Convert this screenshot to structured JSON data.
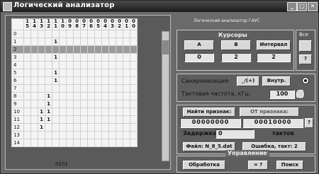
{
  "window": {
    "title": "Логический анализатор",
    "minimize": "_",
    "maximize": "□",
    "close": "✕"
  },
  "grid": {
    "columns": [
      [
        "1",
        "5"
      ],
      [
        "1",
        "4"
      ],
      [
        "1",
        "3"
      ],
      [
        "1",
        "2"
      ],
      [
        "1",
        "1"
      ],
      [
        "1",
        "0"
      ],
      [
        "0",
        "9"
      ],
      [
        "0",
        "8"
      ],
      [
        "0",
        "7"
      ],
      [
        "0",
        "6"
      ],
      [
        "0",
        "5"
      ],
      [
        "0",
        "4"
      ],
      [
        "0",
        "3"
      ],
      [
        "0",
        "2"
      ],
      [
        "0",
        "1"
      ],
      [
        "0",
        "0"
      ]
    ],
    "rows": [
      {
        "label": "0",
        "cells": [
          "",
          "",
          "",
          "",
          "",
          "",
          "",
          "",
          "",
          "",
          "",
          "",
          "",
          "",
          "",
          ""
        ]
      },
      {
        "label": "1",
        "cells": [
          "",
          "",
          "",
          "",
          "1",
          "",
          "",
          "",
          "",
          "",
          "",
          "",
          "",
          "",
          "",
          ""
        ]
      },
      {
        "label": "2",
        "cells": [
          "",
          "",
          "",
          "",
          "",
          "",
          "",
          "",
          "",
          "",
          "",
          "",
          "",
          "",
          "",
          ""
        ]
      },
      {
        "label": "3",
        "cells": [
          "",
          "",
          "",
          "",
          "1",
          "",
          "",
          "",
          "",
          "",
          "",
          "",
          "",
          "",
          "",
          ""
        ]
      },
      {
        "label": "4",
        "cells": [
          "",
          "",
          "",
          "",
          "",
          "",
          "",
          "",
          "",
          "",
          "",
          "",
          "",
          "",
          "",
          ""
        ]
      },
      {
        "label": "5",
        "cells": [
          "",
          "",
          "",
          "",
          "1",
          "",
          "",
          "",
          "",
          "",
          "",
          "",
          "",
          "",
          "",
          ""
        ]
      },
      {
        "label": "6",
        "cells": [
          "",
          "",
          "",
          "",
          "1",
          "",
          "",
          "",
          "",
          "",
          "",
          "",
          "",
          "",
          "",
          ""
        ]
      },
      {
        "label": "7",
        "cells": [
          "",
          "",
          "",
          "",
          "",
          "",
          "",
          "",
          "",
          "",
          "",
          "",
          "",
          "",
          "",
          ""
        ]
      },
      {
        "label": "8",
        "cells": [
          "",
          "",
          "",
          "1",
          "",
          "",
          "",
          "",
          "",
          "",
          "",
          "",
          "",
          "",
          "",
          ""
        ]
      },
      {
        "label": "9",
        "cells": [
          "",
          "",
          "",
          "1",
          "",
          "",
          "",
          "",
          "",
          "",
          "",
          "",
          "",
          "",
          "",
          ""
        ]
      },
      {
        "label": "10",
        "cells": [
          "",
          "",
          "1",
          "1",
          "",
          "",
          "",
          "",
          "",
          "",
          "",
          "",
          "",
          "",
          "",
          ""
        ]
      },
      {
        "label": "11",
        "cells": [
          "",
          "",
          "1",
          "1",
          "",
          "",
          "",
          "",
          "",
          "",
          "",
          "",
          "",
          "",
          "",
          ""
        ]
      },
      {
        "label": "12",
        "cells": [
          "",
          "",
          "1",
          "",
          "",
          "",
          "",
          "",
          "",
          "",
          "",
          "",
          "",
          "",
          "",
          ""
        ]
      },
      {
        "label": "13",
        "cells": [
          "",
          "",
          "",
          "",
          "",
          "",
          "",
          "",
          "",
          "",
          "",
          "",
          "",
          "",
          "",
          ""
        ]
      },
      {
        "label": "14",
        "cells": [
          "",
          "",
          "",
          "",
          "",
          "",
          "",
          "",
          "",
          "",
          "",
          "",
          "",
          "",
          "",
          ""
        ]
      }
    ],
    "highlighted_row": 2,
    "bottom_code": "0101"
  },
  "top_right": {
    "title": "Логический анализатор ГАУС",
    "all_label": "Все"
  },
  "cursors": {
    "header": "Курсоры",
    "a_label": "А",
    "b_label": "В",
    "interval_label": "Интервал",
    "a_value": "0",
    "b_value": "2",
    "interval_value": "2",
    "help": "?"
  },
  "sync": {
    "label": "Синхронизация:",
    "edge": "_/(+)",
    "source": "Внутр.",
    "clock_label": "Тактовая частота, кГц:",
    "clock_value": "100"
  },
  "search": {
    "find_button": "Найти признак:",
    "from_label": "ОТ признака:",
    "pattern_a": "00000000",
    "pattern_b": "00010000",
    "delay_label": "Задержка:",
    "delay_value": "0",
    "tacts_label": "тактов",
    "file_label": "Файл: N_8_5.dat",
    "error_label": "Ошибка, такт: 2"
  },
  "control": {
    "header": "Управление",
    "mode": "Обработка",
    "eq_button": "= ?",
    "search_button": "Поиск"
  }
}
